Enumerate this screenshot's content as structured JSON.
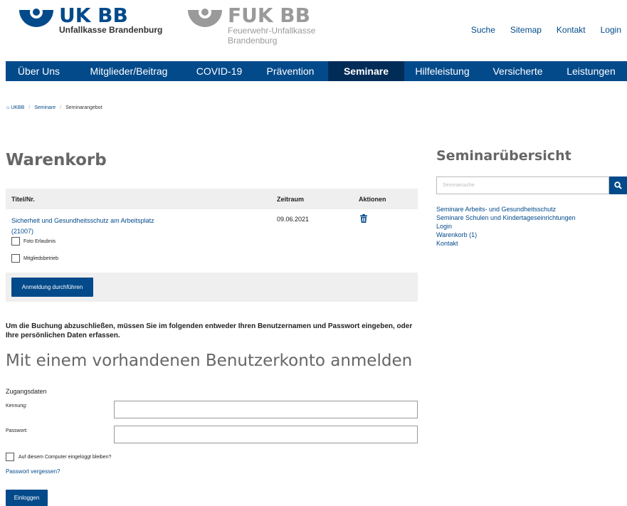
{
  "logos": {
    "ukbb": {
      "name": "UK BB",
      "sub": "Unfallkasse Brandenburg"
    },
    "fukbb": {
      "name": "FUK BB",
      "sub1": "Feuerwehr-Unfallkasse",
      "sub2": "Brandenburg"
    }
  },
  "toplinks": [
    "Suche",
    "Sitemap",
    "Kontakt",
    "Login"
  ],
  "nav": [
    "Über Uns",
    "Mitglieder/Beitrag",
    "COVID-19",
    "Prävention",
    "Seminare",
    "Hilfeleistung",
    "Versicherte",
    "Leistungen"
  ],
  "nav_active": "Seminare",
  "breadcrumb": {
    "home": "UKBB",
    "sep": "/",
    "level1": "Seminare",
    "current": "Seminarangebot"
  },
  "cart": {
    "heading": "Warenkorb",
    "col_title": "Titel/Nr.",
    "col_period": "Zeitraum",
    "col_actions": "Aktionen",
    "item_title": "Sicherheit und Gesundheitsschutz am Arbeitsplatz",
    "item_nr": "(21007)",
    "item_date": "09.06.2021",
    "opt_photo": "Foto Erlaubnis",
    "opt_member": "Mitgliedsbetrieb",
    "submit": "Anmeldung durchführen"
  },
  "info_text": "Um die Buchung abzuschließen, müssen Sie im folgenden entweder Ihren Benutzernamen und Passwort eingeben, oder Ihre persönlichen Daten erfassen.",
  "login": {
    "heading": "Mit einem vorhandenen Benutzerkonto anmelden",
    "section": "Zugangsdaten",
    "label_user": "Kennung:",
    "label_pass": "Passwort:",
    "remember": "Auf diesem Computer eingeloggt bleiben?",
    "forgot": "Passwort vergessen?",
    "submit": "Einloggen"
  },
  "sidebar": {
    "heading": "Seminarübersicht",
    "search_placeholder": "Seminarsuche",
    "links": [
      "Seminare Arbeits- und Gesundheitsschutz",
      "Seminare Schulen und Kindertageseinrichtungen",
      "Login",
      "Warenkorb (1)",
      "Kontakt"
    ]
  },
  "colors": {
    "brand": "#034a8b",
    "nav_active": "#022c58",
    "gray_logo": "#9a9a9a"
  }
}
